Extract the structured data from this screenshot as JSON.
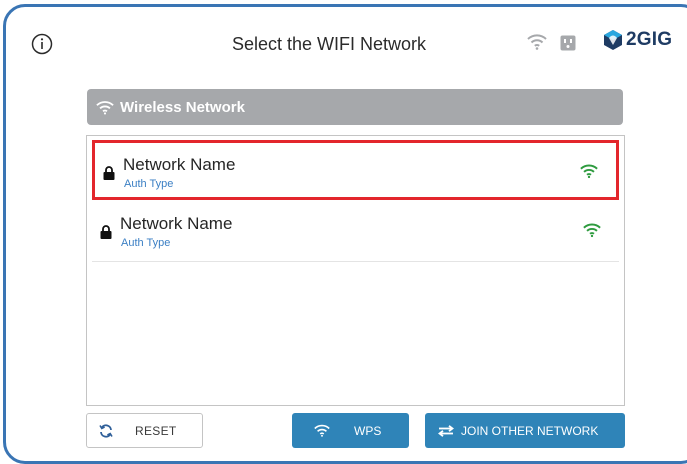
{
  "header": {
    "title": "Select the WIFI Network",
    "logo_text": "2GIG"
  },
  "section": {
    "label": "Wireless Network"
  },
  "networks": [
    {
      "name": "Network Name",
      "auth": "Auth Type",
      "selected": true
    },
    {
      "name": "Network Name",
      "auth": "Auth Type",
      "selected": false
    }
  ],
  "buttons": {
    "reset": "RESET",
    "wps": "WPS",
    "join_other": "JOIN OTHER NETWORK"
  },
  "colors": {
    "frame": "#3a75b4",
    "section_header_bg": "#a6a8ab",
    "selection_border": "#e3262c",
    "signal_green": "#2e9b3f",
    "auth_text": "#3b7fc4",
    "primary_button": "#2f84b8",
    "logo_blue": "#1e3b63",
    "logo_cyan": "#2aa7df"
  },
  "icons": {
    "info": "info-circle-icon",
    "wifi_status": "wifi-icon",
    "outlet": "power-outlet-icon",
    "lock": "lock-icon",
    "signal": "wifi-signal-icon",
    "reset": "refresh-icon",
    "wps": "wifi-icon",
    "join": "swap-arrows-icon"
  }
}
